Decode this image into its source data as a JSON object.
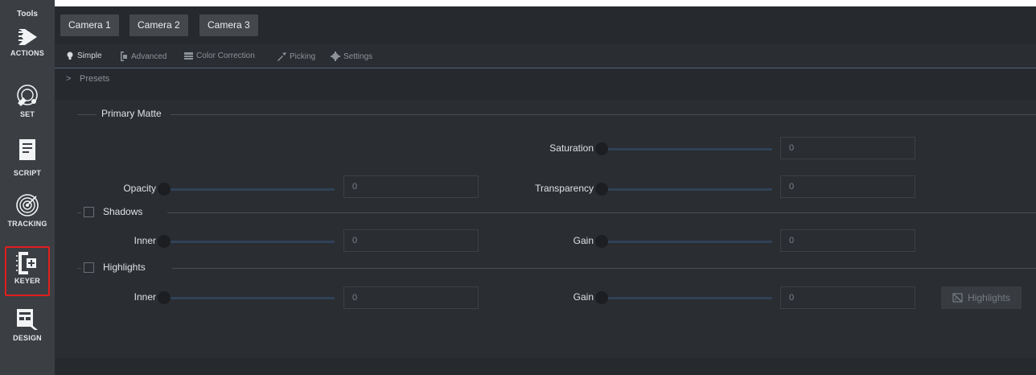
{
  "sidebar": {
    "title": "Tools",
    "items": [
      {
        "label": "ACTIONS",
        "icon": "actions-play-icon"
      },
      {
        "label": "SET",
        "icon": "set-satellite-icon"
      },
      {
        "label": "SCRIPT",
        "icon": "script-document-icon"
      },
      {
        "label": "TRACKING",
        "icon": "tracking-target-icon"
      },
      {
        "label": "KEYER",
        "icon": "keyer-bracket-plus-icon",
        "active": true
      },
      {
        "label": "DESIGN",
        "icon": "design-panel-icon"
      }
    ],
    "active_highlight_color": "#e01e1e"
  },
  "cameras": [
    "Camera 1",
    "Camera 2",
    "Camera 3"
  ],
  "tabs": [
    {
      "label": "Simple",
      "icon": "lightbulb-icon",
      "active": true
    },
    {
      "label": "Advanced",
      "icon": "keyer-advanced-icon"
    },
    {
      "label": "Color Correction",
      "icon": "color-correction-icon"
    },
    {
      "label": "Picking",
      "icon": "eyedropper-icon"
    },
    {
      "label": "Settings",
      "icon": "gear-icon"
    }
  ],
  "presets": {
    "chevron": ">",
    "label": "Presets"
  },
  "primary_matte": {
    "title": "Primary Matte",
    "saturation": {
      "label": "Saturation",
      "value": "0"
    },
    "opacity": {
      "label": "Opacity",
      "value": "0"
    },
    "transparency": {
      "label": "Transparency",
      "value": "0"
    }
  },
  "shadows": {
    "title": "Shadows",
    "inner": {
      "label": "Inner",
      "value": "0"
    },
    "gain": {
      "label": "Gain",
      "value": "0"
    }
  },
  "highlights": {
    "title": "Highlights",
    "inner": {
      "label": "Inner",
      "value": "0"
    },
    "gain": {
      "label": "Gain",
      "value": "0"
    },
    "button_label": "Highlights"
  },
  "colors": {
    "sidebar_bg": "#3b3e43",
    "panel_bg": "#2a2d31",
    "slider_track": "#2f4258",
    "tab_underline": "#4b6478"
  }
}
